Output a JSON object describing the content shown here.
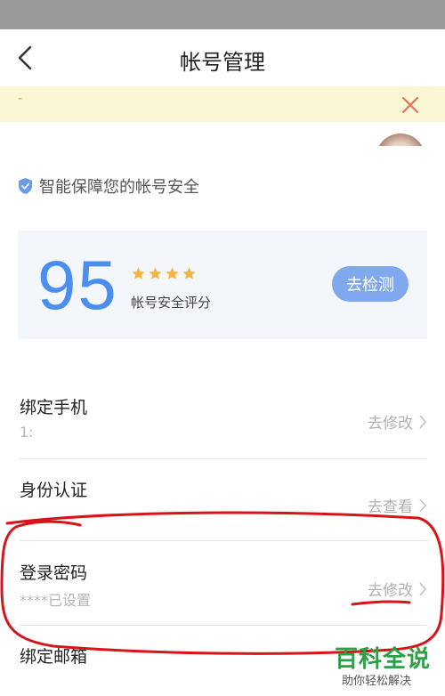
{
  "nav": {
    "title": "帐号管理",
    "back_icon": "chevron-left-icon"
  },
  "notice": {
    "text": "-",
    "close_icon": "close-icon",
    "close_color": "#e0735a"
  },
  "security": {
    "hint": "智能保障您的帐号安全",
    "shield_color": "#6a9be8"
  },
  "score_card": {
    "score": "95",
    "stars": 4,
    "label": "帐号安全评分",
    "button_label": "去检测",
    "score_color": "#4a8ef0",
    "star_color": "#f5b43a"
  },
  "rows": [
    {
      "title": "绑定手机",
      "subtitle": "1:",
      "action": "去修改"
    },
    {
      "title": "身份认证",
      "subtitle": "",
      "action": "去查看"
    },
    {
      "title": "登录密码",
      "subtitle": "****已设置",
      "action": "去修改"
    },
    {
      "title": "绑定邮箱",
      "subtitle": "",
      "action": ""
    }
  ],
  "annotation_color": "#d7141a",
  "watermark": {
    "title": "百科全说",
    "subtitle": "助你轻松解决"
  }
}
